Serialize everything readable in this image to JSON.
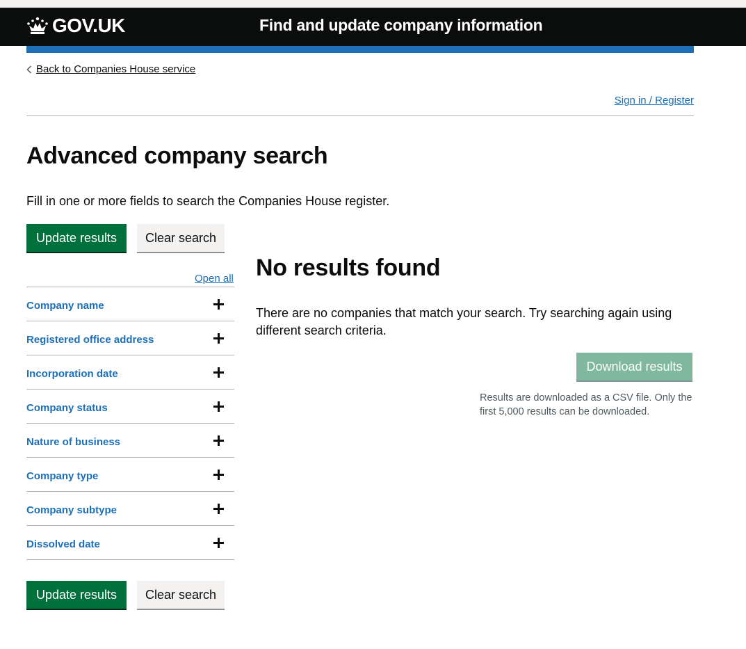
{
  "header": {
    "logo_text": "GOV.UK",
    "service_name": "Find and update company information"
  },
  "nav": {
    "back_link": "Back to Companies House service",
    "sign_in": "Sign in / Register"
  },
  "page": {
    "title": "Advanced company search",
    "intro": "Fill in one or more fields to search the Companies House register."
  },
  "buttons": {
    "update": "Update results",
    "clear": "Clear search",
    "download": "Download results"
  },
  "filters": {
    "open_all": "Open all",
    "items": [
      {
        "label": "Company name"
      },
      {
        "label": "Registered office address"
      },
      {
        "label": "Incorporation date"
      },
      {
        "label": "Company status"
      },
      {
        "label": "Nature of business"
      },
      {
        "label": "Company type"
      },
      {
        "label": "Company subtype"
      },
      {
        "label": "Dissolved date"
      }
    ]
  },
  "results": {
    "heading": "No results found",
    "message": "There are no companies that match your search. Try searching again using different search criteria.",
    "download_note": "Results are downloaded as a CSV file. Only the first 5,000 results can be downloaded."
  },
  "colors": {
    "header_bg": "#0b0c0c",
    "brand_blue": "#1d70b8",
    "button_green": "#00703c",
    "button_disabled_green": "#80b89e"
  },
  "icons": {
    "logo": "crown-icon",
    "back": "chevron-left-icon",
    "expand": "plus-icon"
  }
}
